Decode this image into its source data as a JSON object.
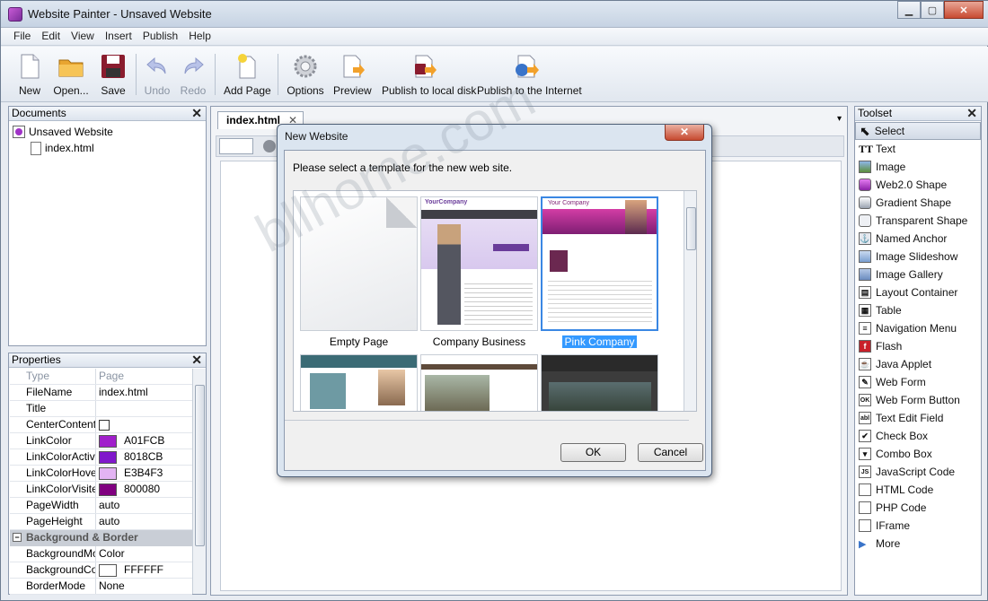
{
  "window": {
    "title": "Website Painter - Unsaved Website"
  },
  "menu": [
    "File",
    "Edit",
    "View",
    "Insert",
    "Publish",
    "Help"
  ],
  "toolbar": {
    "new": "New",
    "open": "Open...",
    "save": "Save",
    "undo": "Undo",
    "redo": "Redo",
    "add_page": "Add Page",
    "options": "Options",
    "preview": "Preview",
    "publish_local": "Publish to local disk",
    "publish_internet": "Publish to the Internet"
  },
  "documents": {
    "title": "Documents",
    "root": "Unsaved Website",
    "page": "index.html"
  },
  "properties": {
    "title": "Properties",
    "header": {
      "col1": "Type",
      "col2": "Page"
    },
    "rows": [
      {
        "name": "FileName",
        "value": "index.html"
      },
      {
        "name": "Title",
        "value": ""
      },
      {
        "name": "CenterContent",
        "value": ""
      },
      {
        "name": "LinkColor",
        "value": "A01FCB",
        "color": "#A01FCB"
      },
      {
        "name": "LinkColorActive",
        "value": "8018CB",
        "color": "#8018CB"
      },
      {
        "name": "LinkColorHover",
        "value": "E3B4F3",
        "color": "#E3B4F3"
      },
      {
        "name": "LinkColorVisited",
        "value": "800080",
        "color": "#800080"
      },
      {
        "name": "PageWidth",
        "value": "auto"
      },
      {
        "name": "PageHeight",
        "value": "auto"
      }
    ],
    "group": "Background & Border",
    "group_rows": [
      {
        "name": "BackgroundMode",
        "value": "Color"
      },
      {
        "name": "BackgroundColor",
        "value": "FFFFFF",
        "color": "#FFFFFF"
      },
      {
        "name": "BorderMode",
        "value": "None"
      }
    ]
  },
  "editor": {
    "tab": "index.html"
  },
  "toolset": {
    "title": "Toolset",
    "items": [
      "Select",
      "Text",
      "Image",
      "Web2.0 Shape",
      "Gradient Shape",
      "Transparent Shape",
      "Named Anchor",
      "Image Slideshow",
      "Image Gallery",
      "Layout Container",
      "Table",
      "Navigation Menu",
      "Flash",
      "Java Applet",
      "Web Form",
      "Web Form Button",
      "Text Edit Field",
      "Check Box",
      "Combo Box",
      "JavaScript Code",
      "HTML Code",
      "PHP Code",
      "IFrame",
      "More"
    ]
  },
  "dialog": {
    "title": "New Website",
    "prompt": "Please select a template for the new web site.",
    "templates": [
      "Empty Page",
      "Company Business",
      "Pink Company"
    ],
    "ok": "OK",
    "cancel": "Cancel"
  },
  "watermark": "bllhome.com",
  "colors": {
    "accent": "#3399ff",
    "close": "#c74a30"
  }
}
